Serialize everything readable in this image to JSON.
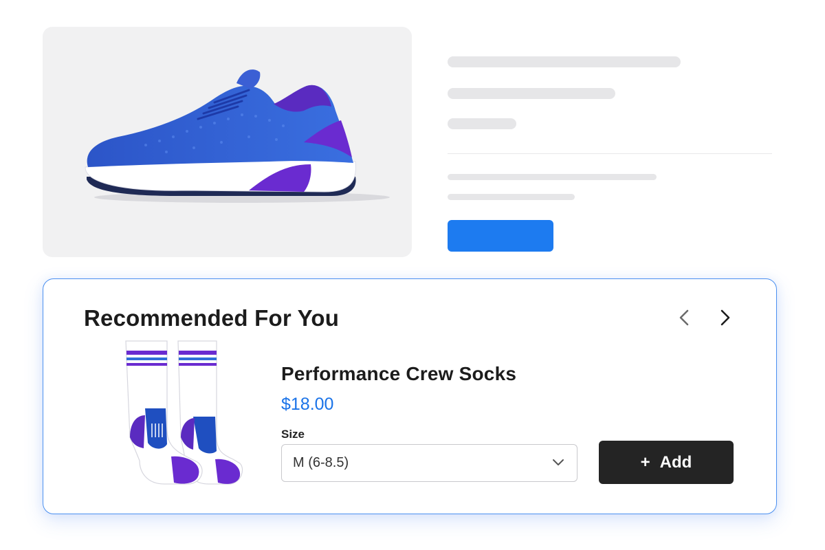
{
  "product": {
    "image_icon": "running-shoe-image"
  },
  "recommendations": {
    "title": "Recommended For You",
    "prev_icon": "chevron-left-icon",
    "next_icon": "chevron-right-icon",
    "item": {
      "image_icon": "socks-image",
      "name": "Performance Crew Socks",
      "price": "$18.00",
      "size_label": "Size",
      "size_selected": "M (6-8.5)",
      "add_plus": "+",
      "add_label": "Add"
    }
  },
  "colors": {
    "accent": "#1d7bf0",
    "price": "#1a73e8",
    "card_border": "#4a8ff0",
    "add_button": "#242424"
  }
}
